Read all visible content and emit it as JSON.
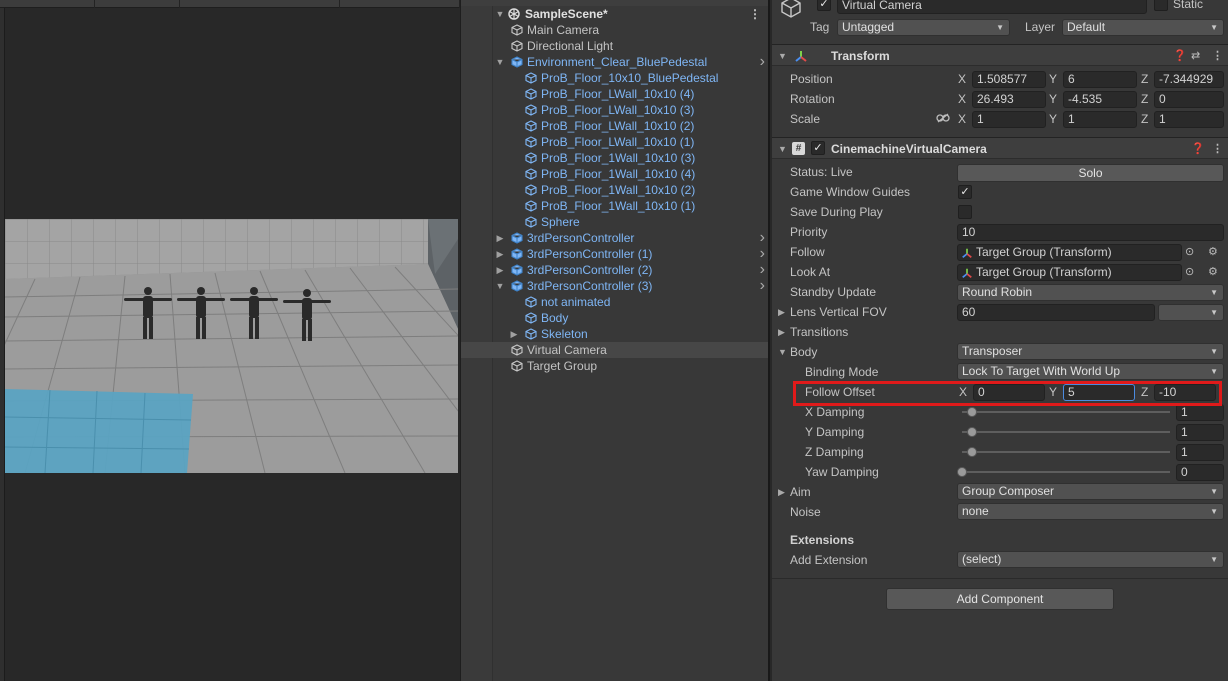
{
  "hierarchy": {
    "scene": "SampleScene*",
    "items": [
      {
        "label": "Main Camera",
        "depth": 1,
        "prefab": false,
        "fold": "",
        "arrow": false
      },
      {
        "label": "Directional Light",
        "depth": 1,
        "prefab": false,
        "fold": "",
        "arrow": false
      },
      {
        "label": "Environment_Clear_BluePedestal",
        "depth": 1,
        "prefab": true,
        "fold": "open",
        "arrow": true
      },
      {
        "label": "ProB_Floor_10x10_BluePedestal",
        "depth": 2,
        "prefab": true,
        "fold": "",
        "arrow": false
      },
      {
        "label": "ProB_Floor_LWall_10x10 (4)",
        "depth": 2,
        "prefab": true,
        "fold": "",
        "arrow": false
      },
      {
        "label": "ProB_Floor_LWall_10x10 (3)",
        "depth": 2,
        "prefab": true,
        "fold": "",
        "arrow": false
      },
      {
        "label": "ProB_Floor_LWall_10x10 (2)",
        "depth": 2,
        "prefab": true,
        "fold": "",
        "arrow": false
      },
      {
        "label": "ProB_Floor_LWall_10x10 (1)",
        "depth": 2,
        "prefab": true,
        "fold": "",
        "arrow": false
      },
      {
        "label": "ProB_Floor_1Wall_10x10 (3)",
        "depth": 2,
        "prefab": true,
        "fold": "",
        "arrow": false
      },
      {
        "label": "ProB_Floor_1Wall_10x10 (4)",
        "depth": 2,
        "prefab": true,
        "fold": "",
        "arrow": false
      },
      {
        "label": "ProB_Floor_1Wall_10x10 (2)",
        "depth": 2,
        "prefab": true,
        "fold": "",
        "arrow": false
      },
      {
        "label": "ProB_Floor_1Wall_10x10 (1)",
        "depth": 2,
        "prefab": true,
        "fold": "",
        "arrow": false
      },
      {
        "label": "Sphere",
        "depth": 2,
        "prefab": true,
        "fold": "",
        "arrow": false
      },
      {
        "label": "3rdPersonController",
        "depth": 1,
        "prefab": true,
        "fold": "closed",
        "arrow": true
      },
      {
        "label": "3rdPersonController (1)",
        "depth": 1,
        "prefab": true,
        "fold": "closed",
        "arrow": true
      },
      {
        "label": "3rdPersonController (2)",
        "depth": 1,
        "prefab": true,
        "fold": "closed",
        "arrow": true
      },
      {
        "label": "3rdPersonController (3)",
        "depth": 1,
        "prefab": true,
        "fold": "open",
        "arrow": true
      },
      {
        "label": "not animated",
        "depth": 2,
        "prefab": true,
        "fold": "",
        "arrow": false
      },
      {
        "label": "Body",
        "depth": 2,
        "prefab": true,
        "fold": "",
        "arrow": false
      },
      {
        "label": "Skeleton",
        "depth": 2,
        "prefab": true,
        "fold": "closed",
        "arrow": false
      },
      {
        "label": "Virtual Camera",
        "depth": 1,
        "prefab": false,
        "fold": "",
        "arrow": false,
        "selected": true
      },
      {
        "label": "Target Group",
        "depth": 1,
        "prefab": false,
        "fold": "",
        "arrow": false
      }
    ]
  },
  "inspector": {
    "object_name": "Virtual Camera",
    "static_label": "Static",
    "tag_label": "Tag",
    "tag_value": "Untagged",
    "layer_label": "Layer",
    "layer_value": "Default",
    "transform": {
      "title": "Transform",
      "position_label": "Position",
      "rotation_label": "Rotation",
      "scale_label": "Scale",
      "axis_x": "X",
      "axis_y": "Y",
      "axis_z": "Z",
      "position": [
        "1.508577",
        "6",
        "-7.344929"
      ],
      "rotation": [
        "26.493",
        "-4.535",
        "0"
      ],
      "scale": [
        "1",
        "1",
        "1"
      ]
    },
    "vcam": {
      "title": "CinemachineVirtualCamera",
      "status_label": "Status: Live",
      "solo_label": "Solo",
      "game_window_guides_label": "Game Window Guides",
      "save_during_play_label": "Save During Play",
      "priority_label": "Priority",
      "priority_value": "10",
      "follow_label": "Follow",
      "follow_value": "Target Group (Transform)",
      "look_at_label": "Look At",
      "look_at_value": "Target Group (Transform)",
      "standby_label": "Standby Update",
      "standby_value": "Round Robin",
      "lens_label": "Lens Vertical FOV",
      "lens_value": "60",
      "transitions_label": "Transitions",
      "body_label": "Body",
      "body_value": "Transposer",
      "binding_mode_label": "Binding Mode",
      "binding_mode_value": "Lock To Target With World Up",
      "follow_offset_label": "Follow Offset",
      "follow_offset": [
        "0",
        "5",
        "-10"
      ],
      "x_damping_label": "X Damping",
      "x_damping_value": "1",
      "x_damping_level": 0.05,
      "y_damping_label": "Y Damping",
      "y_damping_value": "1",
      "y_damping_level": 0.05,
      "z_damping_label": "Z Damping",
      "z_damping_value": "1",
      "z_damping_level": 0.05,
      "yaw_damping_label": "Yaw Damping",
      "yaw_damping_value": "0",
      "yaw_damping_level": 0,
      "aim_label": "Aim",
      "aim_value": "Group Composer",
      "noise_label": "Noise",
      "noise_value": "none",
      "extensions_label": "Extensions",
      "add_extension_label": "Add Extension",
      "add_extension_value": "(select)"
    },
    "add_component_label": "Add Component"
  },
  "colors": {
    "prefab_text": "#7fb6f5",
    "highlight": "#e01a1a",
    "floor_blue": "#5ba3c2"
  }
}
